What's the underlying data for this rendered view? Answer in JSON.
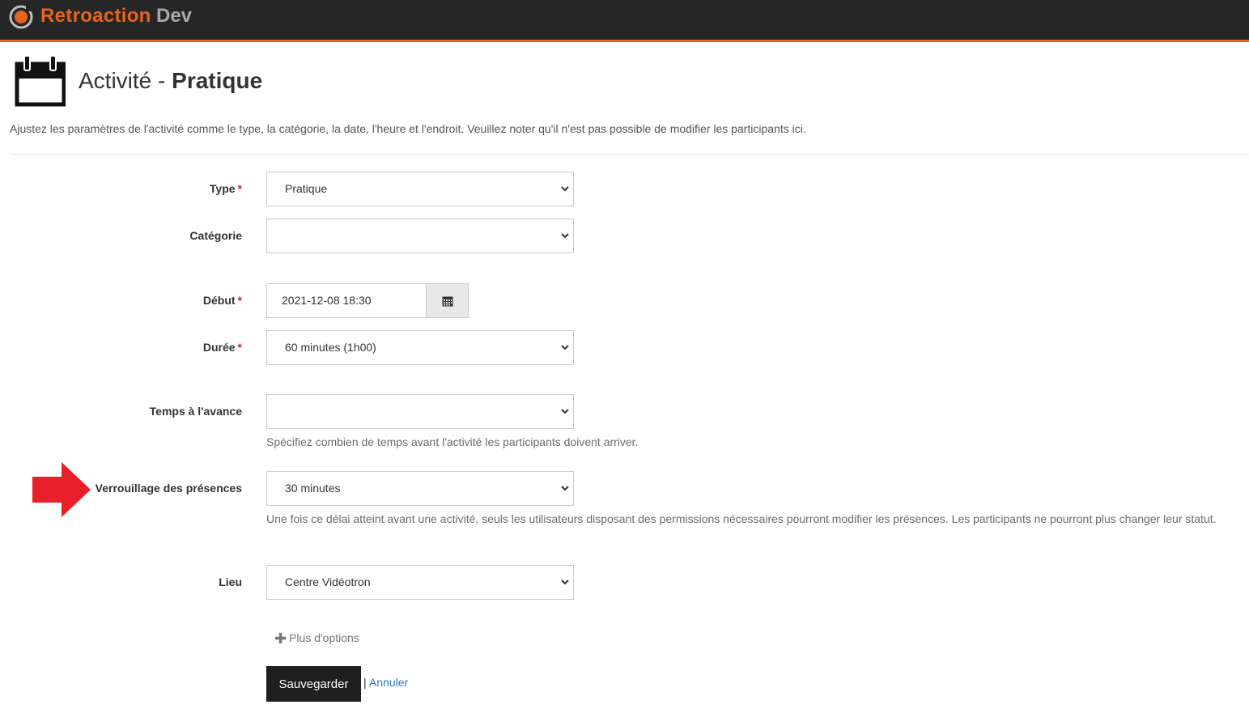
{
  "header": {
    "brand_name": "Retroaction",
    "environment": "Dev",
    "accent_color": "#e8631c"
  },
  "page": {
    "icon": "calendar-icon",
    "title_prefix": "Activité - ",
    "title_main": "Pratique",
    "description": "Ajustez les paramètres de l'activité comme le type, la catégorie, la date, l'heure et l'endroit. Veuillez noter qu'il n'est pas possible de modifier les participants ici."
  },
  "form": {
    "type": {
      "label": "Type",
      "required_mark": "*",
      "value": "Pratique"
    },
    "category": {
      "label": "Catégorie",
      "value": ""
    },
    "start": {
      "label": "Début",
      "required_mark": "*",
      "value": "2021-12-08 18:30"
    },
    "duration": {
      "label": "Durée",
      "required_mark": "*",
      "value": "60 minutes (1h00)"
    },
    "advance_time": {
      "label": "Temps à l'avance",
      "value": "",
      "help": "Spécifiez combien de temps avant l'activité les participants doivent arriver."
    },
    "attendance_lock": {
      "label": "Verrouillage des présences",
      "value": "30 minutes",
      "help": "Une fois ce délai atteint avant une activité, seuls les utilisateurs disposant des permissions nécessaires pourront modifier les présences. Les participants ne pourront plus changer leur statut."
    },
    "location": {
      "label": "Lieu",
      "value": "Centre Vidéotron"
    },
    "more_options": "Plus d'options",
    "save": "Sauvegarder",
    "separator": "|",
    "cancel": "Annuler"
  }
}
